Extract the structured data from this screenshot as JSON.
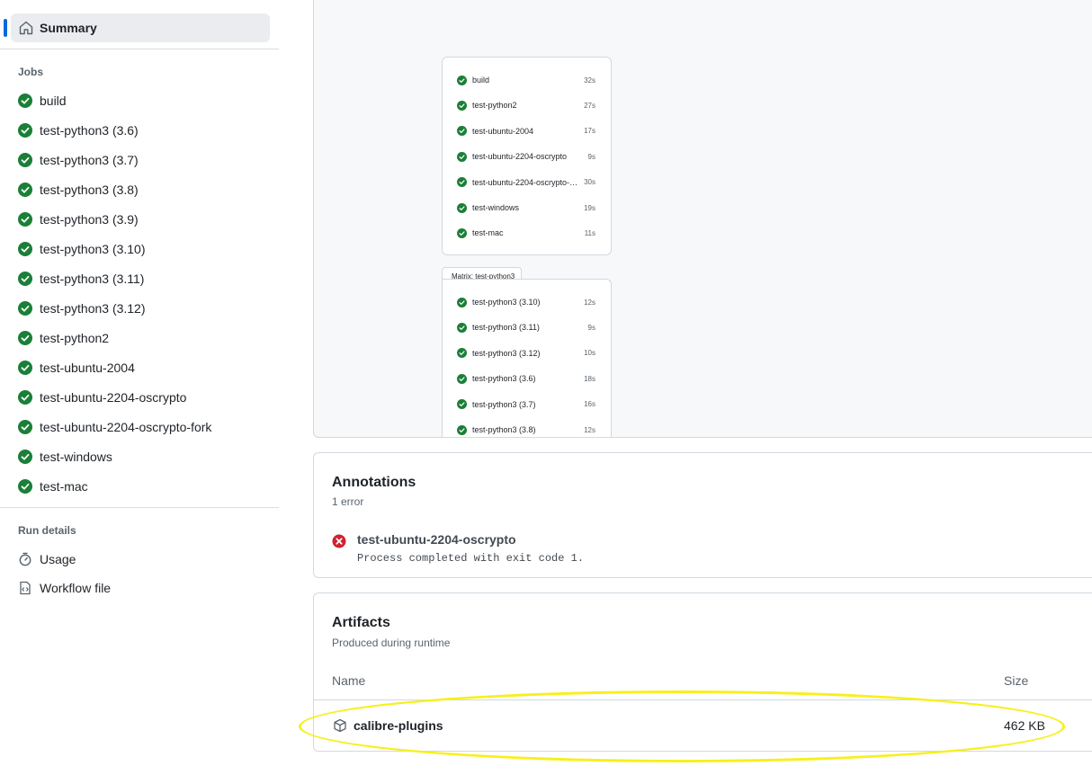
{
  "sidebar": {
    "summary_label": "Summary",
    "jobs_heading": "Jobs",
    "jobs": [
      "build",
      "test-python3 (3.6)",
      "test-python3 (3.7)",
      "test-python3 (3.8)",
      "test-python3 (3.9)",
      "test-python3 (3.10)",
      "test-python3 (3.11)",
      "test-python3 (3.12)",
      "test-python2",
      "test-ubuntu-2004",
      "test-ubuntu-2204-oscrypto",
      "test-ubuntu-2204-oscrypto-fork",
      "test-windows",
      "test-mac"
    ],
    "run_details_heading": "Run details",
    "usage_label": "Usage",
    "workflow_file_label": "Workflow file"
  },
  "graph": {
    "jobs": [
      {
        "name": "build",
        "duration": "32s"
      },
      {
        "name": "test-python2",
        "duration": "27s"
      },
      {
        "name": "test-ubuntu-2004",
        "duration": "17s"
      },
      {
        "name": "test-ubuntu-2204-oscrypto",
        "duration": "9s"
      },
      {
        "name": "test-ubuntu-2204-oscrypto-fork",
        "duration": "30s"
      },
      {
        "name": "test-windows",
        "duration": "19s"
      },
      {
        "name": "test-mac",
        "duration": "11s"
      }
    ],
    "matrix_label": "Matrix: test-python3",
    "matrix_jobs": [
      {
        "name": "test-python3 (3.10)",
        "duration": "12s"
      },
      {
        "name": "test-python3 (3.11)",
        "duration": "9s"
      },
      {
        "name": "test-python3 (3.12)",
        "duration": "10s"
      },
      {
        "name": "test-python3 (3.6)",
        "duration": "18s"
      },
      {
        "name": "test-python3 (3.7)",
        "duration": "16s"
      },
      {
        "name": "test-python3 (3.8)",
        "duration": "12s"
      }
    ]
  },
  "annotations": {
    "title": "Annotations",
    "count": "1 error",
    "items": [
      {
        "title": "test-ubuntu-2204-oscrypto",
        "message": "Process completed with exit code 1."
      }
    ]
  },
  "artifacts": {
    "title": "Artifacts",
    "subtitle": "Produced during runtime",
    "col_name": "Name",
    "col_size": "Size",
    "items": [
      {
        "name": "calibre-plugins",
        "size": "462 KB"
      }
    ]
  },
  "colors": {
    "success": "#1a7f37",
    "error": "#cf222e",
    "accent": "#0969da",
    "highlight": "#f7f01c"
  }
}
